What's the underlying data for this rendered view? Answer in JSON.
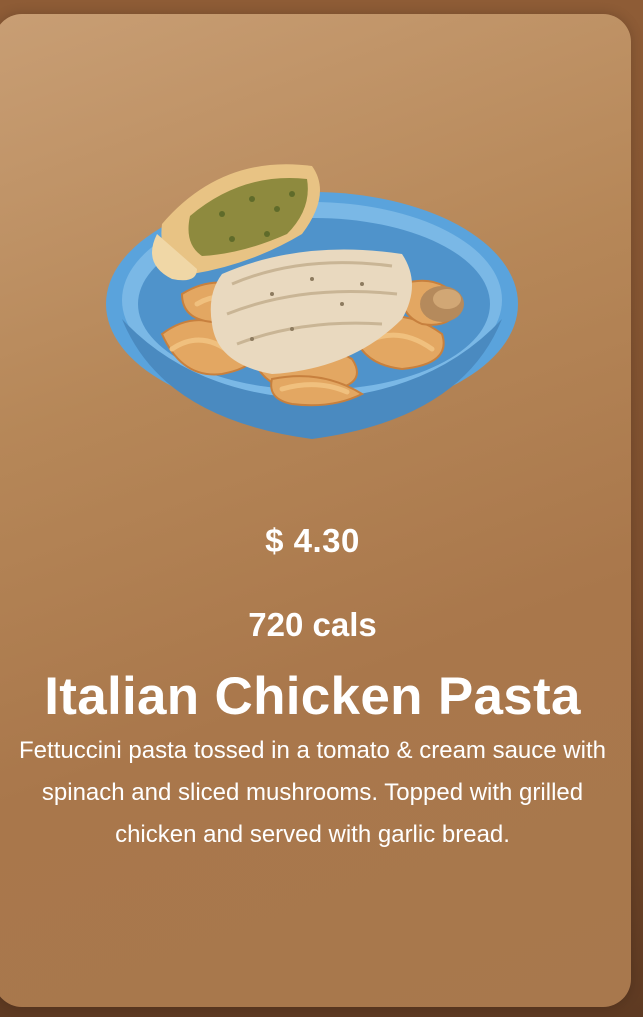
{
  "item": {
    "price": "$ 4.30",
    "calories": "720 cals",
    "name": "Italian Chicken Pasta",
    "description": "Fettuccini pasta tossed in a tomato & cream sauce with spinach and sliced mushrooms. Topped with grilled chicken and served with garlic bread.",
    "image": "pasta-bowl-image"
  },
  "colors": {
    "card_top": "#c89e74",
    "card_bottom": "#a8784d",
    "text": "#ffffff",
    "bowl": "#5aa3dc"
  }
}
